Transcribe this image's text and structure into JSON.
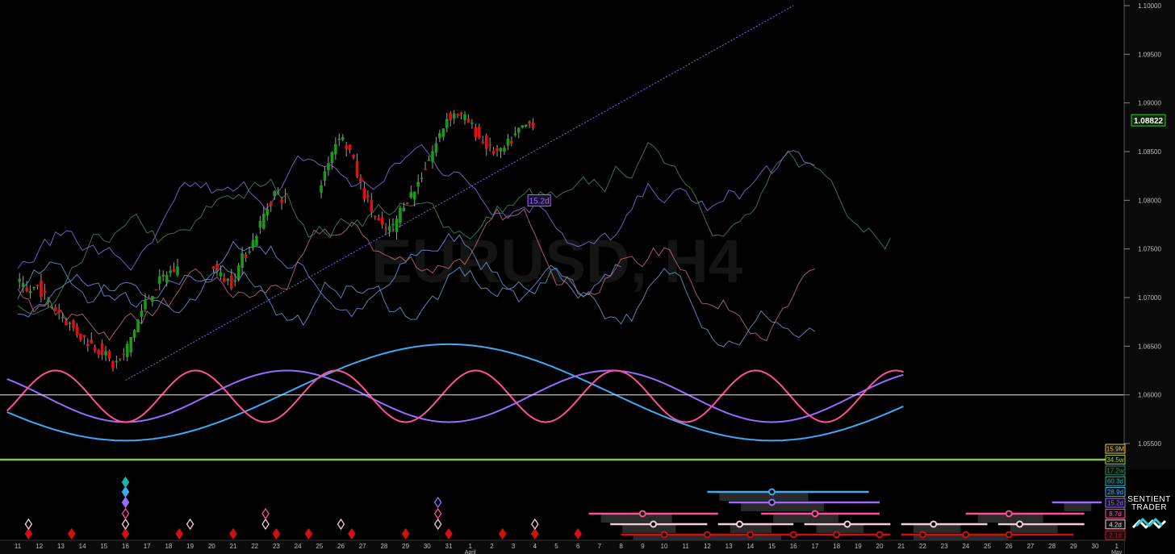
{
  "app": {
    "watermark": "EURUSD, H4",
    "brand_line1": "SENTIENT",
    "brand_line2": "TRADER",
    "logo_icon": "sentient-trader-logo-icon"
  },
  "price_axis": {
    "ticks": [
      "1.10000",
      "1.09500",
      "1.09000",
      "1.08500",
      "1.08000",
      "1.07500",
      "1.07000",
      "1.06500",
      "1.06000",
      "1.05500"
    ],
    "last_price": "1.08822"
  },
  "x_axis": {
    "dates": [
      "11",
      "12",
      "13",
      "14",
      "15",
      "16",
      "17",
      "18",
      "19",
      "20",
      "21",
      "22",
      "23",
      "24",
      "25",
      "26",
      "27",
      "28",
      "29",
      "30",
      "31",
      "1",
      "2",
      "3",
      "4",
      "5",
      "6",
      "7",
      "8",
      "9",
      "10",
      "11",
      "12",
      "13",
      "14",
      "15",
      "16",
      "17",
      "18",
      "19",
      "20",
      "21",
      "22",
      "23",
      "24",
      "25",
      "26",
      "27",
      "28",
      "29",
      "30",
      "1"
    ],
    "month_labels": [
      {
        "at_index": 21,
        "text": "April"
      },
      {
        "at_index": 51,
        "text": "May"
      }
    ]
  },
  "cycle_labels": [
    {
      "text": "15.9M",
      "color": "#e8c53a"
    },
    {
      "text": "34.5w",
      "color": "#9acd32"
    },
    {
      "text": "17.2w",
      "color": "#2e8b57"
    },
    {
      "text": "60.3d",
      "color": "#20b2aa"
    },
    {
      "text": "28.9d",
      "color": "#3fa9f5"
    },
    {
      "text": "15.2d",
      "color": "#9b6bff"
    },
    {
      "text": "8.7d",
      "color": "#ff4f9a"
    },
    {
      "text": "4.2d",
      "color": "#f0d0dc"
    },
    {
      "text": "2.1d",
      "color": "#d01010"
    }
  ],
  "annotation": {
    "text": "15.2d",
    "color": "#9b6bff"
  },
  "colors": {
    "bull": "#1a9a1a",
    "bear": "#e01010",
    "baseline": "#d0d0d0",
    "green_line": "#8bc34a",
    "blue_cycle": "#3fa9f5",
    "purple_cycle": "#9b6bff",
    "pink_cycle": "#ff4f9a",
    "trend": "#7b68ee"
  },
  "chart_data": {
    "type": "line",
    "title": "EURUSD, H4",
    "ylim": [
      1.053,
      1.1
    ],
    "x_tick_labels": [
      "11",
      "12",
      "13",
      "14",
      "15",
      "16",
      "17",
      "18",
      "19",
      "20",
      "21",
      "22",
      "23",
      "24",
      "25",
      "26",
      "27",
      "28",
      "29",
      "30",
      "31",
      "1",
      "2",
      "3",
      "4",
      "5",
      "6",
      "7",
      "8",
      "9",
      "10",
      "11",
      "12",
      "13",
      "14",
      "15",
      "16",
      "17",
      "18",
      "19",
      "20",
      "21",
      "22",
      "23",
      "24",
      "25",
      "26",
      "27",
      "28",
      "29",
      "30",
      "1"
    ],
    "price_series": {
      "name": "EURUSD H4",
      "x": [
        11,
        11.5,
        12,
        12.5,
        13,
        13.5,
        14,
        14.5,
        15,
        15.5,
        16,
        16.5,
        17,
        17.5,
        18,
        18.5,
        19,
        19.5,
        20,
        20.5,
        21,
        21.5,
        22,
        22.5,
        23,
        23.5,
        24,
        24.5,
        25,
        25.5,
        26,
        26.5,
        27,
        27.5,
        28,
        28.5,
        29,
        29.5,
        30,
        30.5,
        31,
        31.5,
        32,
        32.5,
        33,
        33.5,
        34,
        34.5,
        35,
        35.5,
        36,
        36.5,
        37,
        37.5,
        38
      ],
      "y": [
        1.0718,
        1.0705,
        1.0712,
        1.0695,
        1.0685,
        1.0672,
        1.066,
        1.0652,
        1.0645,
        1.063,
        1.064,
        1.0668,
        1.0695,
        1.0712,
        1.0725,
        1.073,
        null,
        null,
        1.0738,
        1.0722,
        1.0715,
        1.074,
        1.0758,
        1.0785,
        1.0808,
        1.08,
        null,
        null,
        1.0805,
        1.0842,
        1.0868,
        1.085,
        1.0815,
        1.079,
        1.077,
        1.0772,
        1.0798,
        1.081,
        1.0835,
        1.0858,
        1.0885,
        1.089,
        1.088,
        1.0865,
        1.0852,
        1.0848,
        1.0862,
        1.0875,
        1.088,
        null,
        null,
        null,
        null,
        null,
        null
      ]
    },
    "series": [
      {
        "name": "28.9d",
        "color": "#3fa9f5",
        "type": "wave",
        "x_trough": [
          16,
          46
        ],
        "ylim_band": [
          1.0553,
          1.0652
        ]
      },
      {
        "name": "15.2d",
        "color": "#9b6bff",
        "type": "wave",
        "x_trough": [
          16,
          31,
          46
        ],
        "ylim_band": [
          1.0572,
          1.0625
        ]
      },
      {
        "name": "8.7d",
        "color": "#ff4f9a",
        "type": "wave",
        "x_trough": [
          16,
          22.5,
          31,
          39,
          46,
          51
        ],
        "ylim_band": [
          1.0572,
          1.0625
        ]
      },
      {
        "name": "trend",
        "color": "#7b68ee",
        "type": "line",
        "x": [
          16,
          47
        ],
        "y": [
          1.0615,
          1.1
        ]
      }
    ],
    "baseline": 1.06,
    "green_line": 1.0538,
    "grid": false
  }
}
